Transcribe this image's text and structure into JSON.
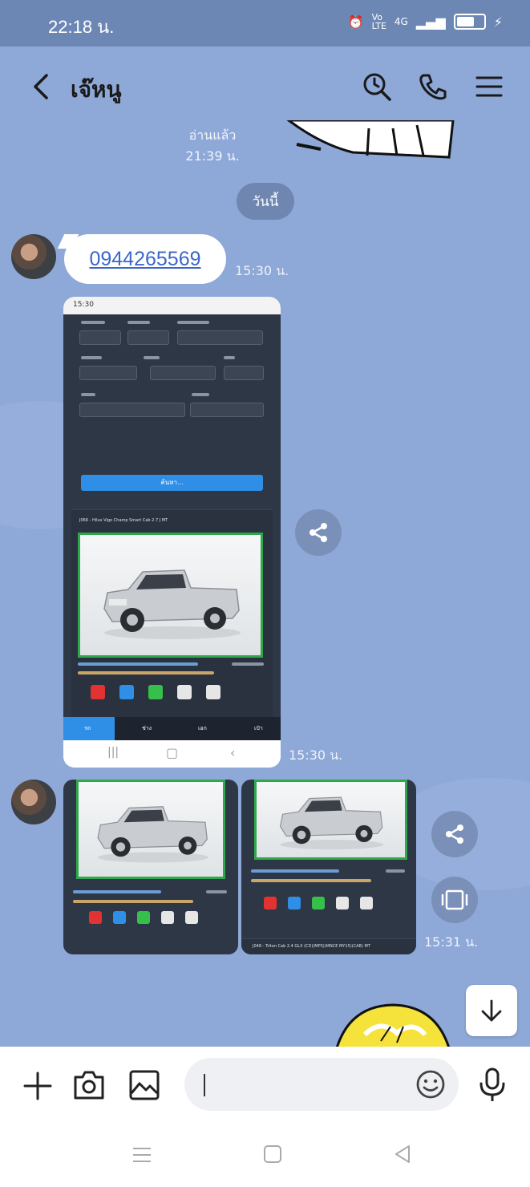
{
  "status_bar": {
    "time": "22:18 น.",
    "network": "4G"
  },
  "header": {
    "title": "เจ๊หนู"
  },
  "chat": {
    "read_label": "อ่านแล้ว",
    "read_time": "21:39 น.",
    "day_chip": "วันนี้",
    "messages": [
      {
        "type": "text",
        "text": "0944265569",
        "time": "15:30 น."
      },
      {
        "type": "image",
        "time": "15:30 น."
      },
      {
        "type": "image-group",
        "time": "15:31 น."
      }
    ]
  },
  "screenshot": {
    "statusbar_time": "15:30",
    "listing_title": "J066 - Hilux Vigo Champ Smart Cab 2.7 J MT",
    "search_label": "ค้นหา...",
    "tabs": [
      "รถ",
      "ช่าง",
      "เอก",
      "เป๋า"
    ]
  },
  "thumb2": {
    "listing_title": "J048 - Triton Cab 2.4 GLX (CD)(MPS)(MNCE MY15)(CAB) MT"
  },
  "colors": {
    "background": "#8ea8d8",
    "status_bar": "#6d87b5",
    "link": "#3b67c9",
    "accent_blue": "#2f8fe6",
    "accent_green": "#2fa84b"
  }
}
